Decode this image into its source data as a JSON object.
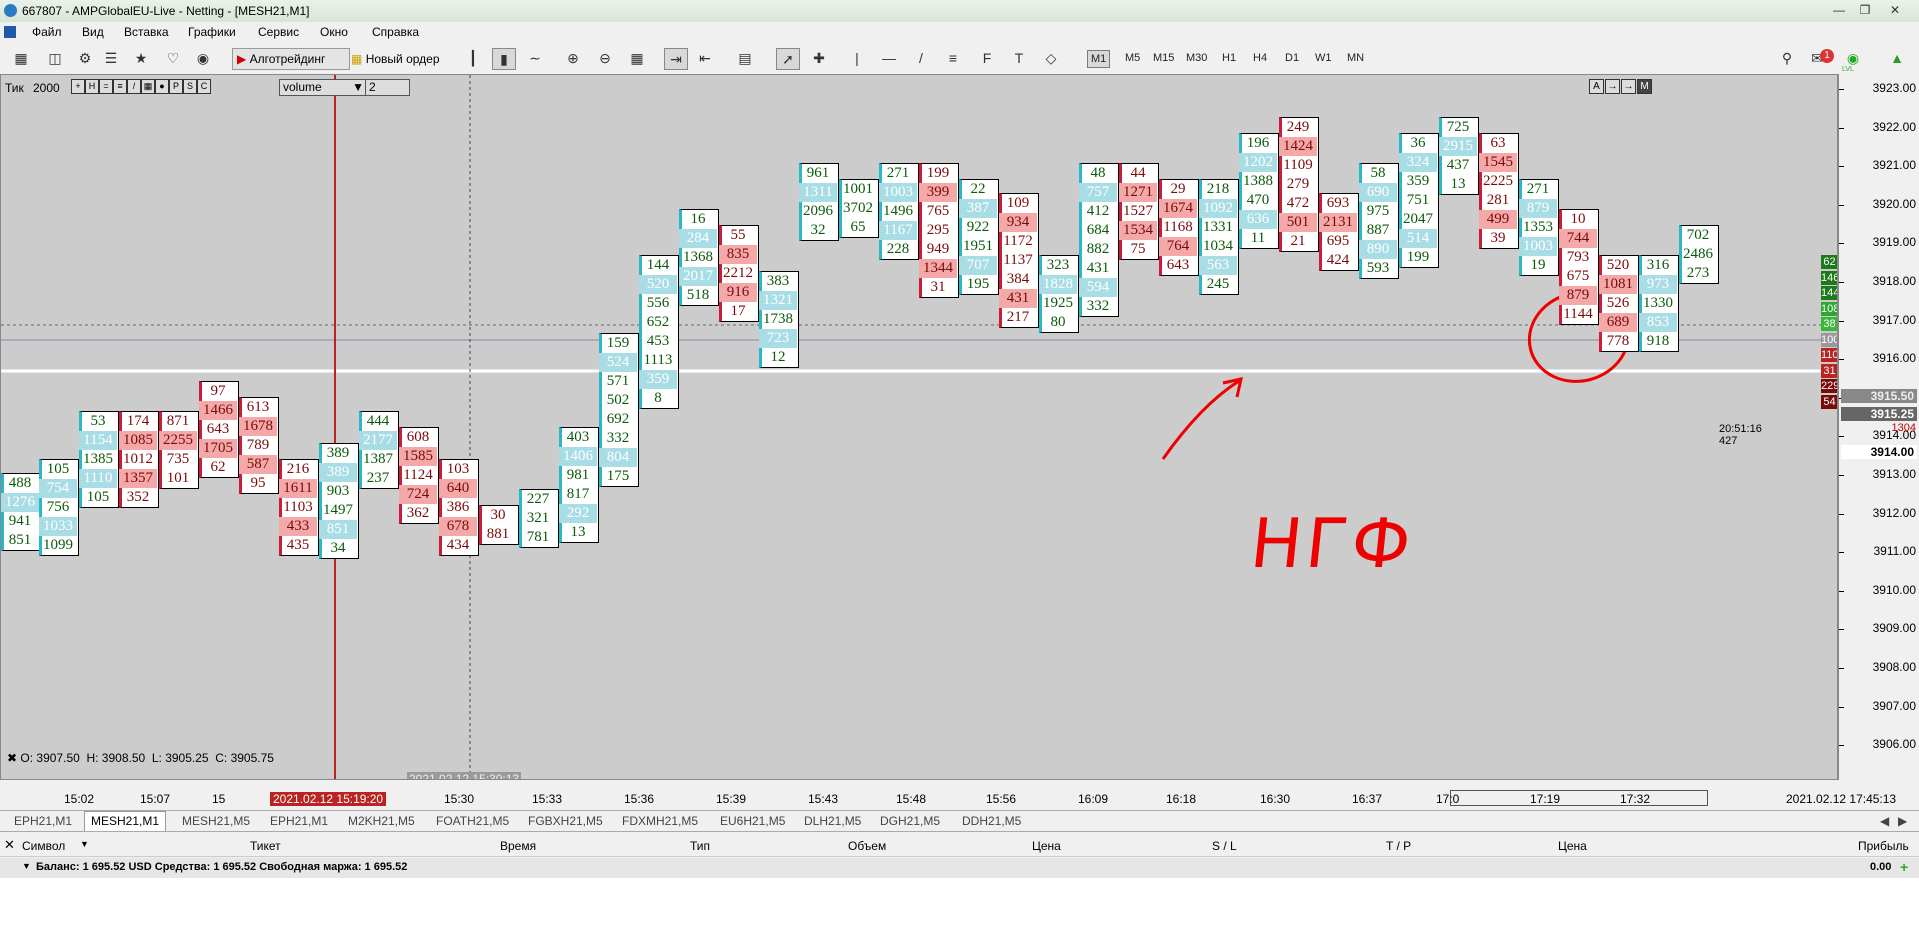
{
  "window": {
    "title": "667807 - AMPGlobalEU-Live - Netting - [MESH21,M1]",
    "buttons": [
      "—",
      "❐",
      "✕"
    ]
  },
  "menu": [
    "Файл",
    "Вид",
    "Вставка",
    "Графики",
    "Сервис",
    "Окно",
    "Справка"
  ],
  "toolbar": {
    "algotrading_label": "Алготрейдинг",
    "new_order_label": "Новый ордер",
    "timeframes": [
      "M1",
      "M5",
      "M15",
      "M30",
      "H1",
      "H4",
      "D1",
      "W1",
      "MN"
    ],
    "selected_timeframe": "M1",
    "notification_count": "1",
    "lvl_label": "LVL"
  },
  "indicator_bar": {
    "label": "Тик",
    "value": "2000",
    "buttons": [
      "+",
      "H",
      "=",
      "≡",
      "/",
      "▦",
      "●",
      "P",
      "S",
      "C"
    ],
    "select_value": "volume",
    "spin_value": "2",
    "right_buttons": [
      "A",
      "→",
      "→",
      "M"
    ]
  },
  "ohlc": {
    "o": "O: 3907.50",
    "h": "H: 3908.50",
    "l": "L: 3905.25",
    "c": "C: 3905.75"
  },
  "price_axis": {
    "ticks": [
      "3923.00",
      "3922.00",
      "3921.00",
      "3920.00",
      "3919.00",
      "3918.00",
      "3917.00",
      "3916.00",
      "3915.00",
      "3914.00",
      "3913.00",
      "3912.00",
      "3911.00",
      "3910.00",
      "3909.00",
      "3908.00",
      "3907.00",
      "3906.00"
    ],
    "bid_label": "3915.50",
    "last_label": "3915.25",
    "line_label": "3914.00",
    "small_red": "1304",
    "tick_badges": [
      "62",
      "146",
      "144",
      "108",
      "38",
      "100",
      "110",
      "31",
      "229",
      "54"
    ],
    "timer": "20:51:16",
    "timer_count": "427"
  },
  "time_axis": {
    "labels": [
      "15:02",
      "15:07",
      "15",
      "15:30",
      "15:33",
      "15:36",
      "15:39",
      "15:43",
      "15:48",
      "15:56",
      "16:09",
      "16:18",
      "16:30",
      "16:37",
      "17:0",
      "17:19",
      "17:32"
    ],
    "cursor_time": "2021.02.12 15:19:20",
    "crosshair_time": "2021.02.12 15:30:13",
    "right_date": "2021.02.12 17:45:13"
  },
  "symbol_tabs": [
    "EPH21,M1",
    "MESH21,M1",
    "MESH21,M5",
    "EPH21,M1",
    "M2KH21,M5",
    "FOATH21,M5",
    "FGBXH21,M5",
    "FDXMH21,M5",
    "EU6H21,M5",
    "DLH21,M5",
    "DGH21,M5",
    "DDH21,M5"
  ],
  "active_symbol_tab": "MESH21,M1",
  "orders": {
    "headers": [
      "Символ",
      "Тикет",
      "Время",
      "Тип",
      "Объем",
      "Цена",
      "S / L",
      "T / P",
      "Цена",
      "Прибыль"
    ],
    "balance_text": "Баланс: 1 695.52 USD  Средства: 1 695.52  Свободная маржа: 1 695.52",
    "profit": "0.00"
  },
  "annotation": {
    "text": "НГФ"
  },
  "colors": {
    "bull": "#2ab7c8",
    "bear": "#c81e3c",
    "green_text": "#0a5a0a",
    "red_text": "#7a0a0a"
  },
  "footprint_candles": [
    {
      "dir": "up",
      "values": [
        "488",
        "1276",
        "941",
        "851"
      ]
    },
    {
      "dir": "up",
      "values": [
        "105",
        "754",
        "756",
        "1033",
        "1099"
      ]
    },
    {
      "dir": "up",
      "values": [
        "53",
        "1154",
        "1385",
        "1110",
        "105"
      ]
    },
    {
      "dir": "down",
      "values": [
        "174",
        "1085",
        "1012",
        "1357",
        "352"
      ]
    },
    {
      "dir": "down",
      "values": [
        "871",
        "2255",
        "735",
        "101"
      ]
    },
    {
      "dir": "down",
      "values": [
        "97",
        "1466",
        "643",
        "1705",
        "62"
      ]
    },
    {
      "dir": "down",
      "values": [
        "613",
        "1678",
        "789",
        "587",
        "95"
      ]
    },
    {
      "dir": "down",
      "values": [
        "216",
        "1611",
        "1103",
        "433",
        "435"
      ]
    },
    {
      "dir": "up",
      "values": [
        "389",
        "389",
        "903",
        "1497",
        "851",
        "34"
      ]
    },
    {
      "dir": "up",
      "values": [
        "444",
        "2177",
        "1387",
        "237"
      ]
    },
    {
      "dir": "down",
      "values": [
        "608",
        "1585",
        "1124",
        "724",
        "362"
      ]
    },
    {
      "dir": "down",
      "values": [
        "103",
        "640",
        "386",
        "678",
        "434"
      ]
    },
    {
      "dir": "down",
      "values": [
        "30",
        "881"
      ]
    },
    {
      "dir": "up",
      "values": [
        "227",
        "321",
        "781"
      ]
    },
    {
      "dir": "up",
      "values": [
        "403",
        "1406",
        "981",
        "817",
        "292",
        "13"
      ]
    },
    {
      "dir": "up",
      "values": [
        "159",
        "524",
        "571",
        "502",
        "692",
        "332",
        "804",
        "175"
      ]
    },
    {
      "dir": "up",
      "values": [
        "144",
        "520",
        "556",
        "652",
        "453",
        "1113",
        "359",
        "8"
      ]
    },
    {
      "dir": "up",
      "values": [
        "16",
        "284",
        "1368",
        "2017",
        "518"
      ]
    },
    {
      "dir": "down",
      "values": [
        "55",
        "835",
        "2212",
        "916",
        "17"
      ]
    },
    {
      "dir": "up",
      "values": [
        "383",
        "1321",
        "1738",
        "723",
        "12"
      ]
    },
    {
      "dir": "up",
      "values": [
        "961",
        "1311",
        "2096",
        "32"
      ]
    },
    {
      "dir": "up",
      "values": [
        "1001",
        "3702",
        "65"
      ]
    },
    {
      "dir": "up",
      "values": [
        "271",
        "1003",
        "1496",
        "1167",
        "228"
      ]
    },
    {
      "dir": "down",
      "values": [
        "199",
        "399",
        "765",
        "295",
        "949",
        "1344",
        "31"
      ]
    },
    {
      "dir": "up",
      "values": [
        "22",
        "387",
        "922",
        "1951",
        "707",
        "195"
      ]
    },
    {
      "dir": "down",
      "values": [
        "109",
        "934",
        "1172",
        "1137",
        "384",
        "431",
        "217"
      ]
    },
    {
      "dir": "up",
      "values": [
        "323",
        "1828",
        "1925",
        "80"
      ]
    },
    {
      "dir": "up",
      "values": [
        "48",
        "757",
        "412",
        "684",
        "882",
        "431",
        "594",
        "332"
      ]
    },
    {
      "dir": "down",
      "values": [
        "44",
        "1271",
        "1527",
        "1534",
        "75"
      ]
    },
    {
      "dir": "down",
      "values": [
        "29",
        "1674",
        "1168",
        "764",
        "643"
      ]
    },
    {
      "dir": "up",
      "values": [
        "218",
        "1092",
        "1331",
        "1034",
        "563",
        "245"
      ]
    },
    {
      "dir": "up",
      "values": [
        "196",
        "1202",
        "1388",
        "470",
        "636",
        "11"
      ]
    },
    {
      "dir": "down",
      "values": [
        "249",
        "1424",
        "1109",
        "279",
        "472",
        "501",
        "21"
      ]
    },
    {
      "dir": "down",
      "values": [
        "693",
        "2131",
        "695",
        "424"
      ]
    },
    {
      "dir": "up",
      "values": [
        "58",
        "690",
        "975",
        "887",
        "890",
        "593"
      ]
    },
    {
      "dir": "up",
      "values": [
        "36",
        "324",
        "359",
        "751",
        "2047",
        "514",
        "199"
      ]
    },
    {
      "dir": "up",
      "values": [
        "725",
        "2915",
        "437",
        "13"
      ]
    },
    {
      "dir": "down",
      "values": [
        "63",
        "1545",
        "2225",
        "281",
        "499",
        "39"
      ]
    },
    {
      "dir": "up",
      "values": [
        "271",
        "879",
        "1353",
        "1003",
        "19"
      ]
    },
    {
      "dir": "down",
      "values": [
        "10",
        "744",
        "793",
        "675",
        "879",
        "1144"
      ]
    },
    {
      "dir": "down",
      "values": [
        "520",
        "1081",
        "526",
        "689",
        "778"
      ]
    },
    {
      "dir": "up",
      "values": [
        "316",
        "973",
        "1330",
        "853",
        "918"
      ]
    },
    {
      "dir": "up",
      "values": [
        "702",
        "2486",
        "273"
      ]
    }
  ]
}
